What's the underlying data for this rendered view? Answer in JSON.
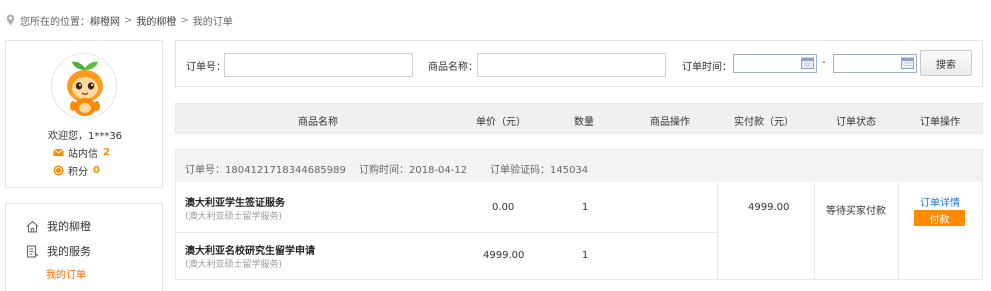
{
  "breadcrumb": {
    "prefix": "您所在的位置：",
    "items": [
      "柳橙网",
      "我的柳橙",
      "我的订单"
    ],
    "separator": ">"
  },
  "user": {
    "welcome": "欢迎您，1***36",
    "messages_label": "站内信",
    "messages_count": "2",
    "points_label": "积分",
    "points_count": "0"
  },
  "menu": {
    "home": "我的柳橙",
    "services": "我的服务",
    "orders": "我的订单"
  },
  "search": {
    "order_no_label": "订单号：",
    "order_no_value": "",
    "product_label": "商品名称：",
    "product_value": "",
    "time_label": "订单时间：",
    "date_from": "",
    "date_to": "",
    "dash": "-",
    "button": "搜索"
  },
  "table": {
    "columns": [
      "商品名称",
      "单价（元）",
      "数量",
      "商品操作",
      "实付款（元）",
      "订单状态",
      "订单操作"
    ]
  },
  "order": {
    "order_no": "订单号：1804121718344685989",
    "order_time": "订购时间：2018-04-12",
    "verify_code": "订单验证码：145034",
    "items": [
      {
        "name": "澳大利亚学生签证服务",
        "sub": "(澳大利亚硕士留学服务)",
        "price": "0.00",
        "qty": "1"
      },
      {
        "name": "澳大利亚名校研究生留学申请",
        "sub": "(澳大利亚硕士留学服务)",
        "price": "4999.00",
        "qty": "1"
      }
    ],
    "total": "4999.00",
    "status": "等待买家付款",
    "detail_link": "订单详情",
    "pay_button": "付款"
  },
  "colors": {
    "accent": "#ff8a00",
    "link": "#1e7ad4"
  }
}
